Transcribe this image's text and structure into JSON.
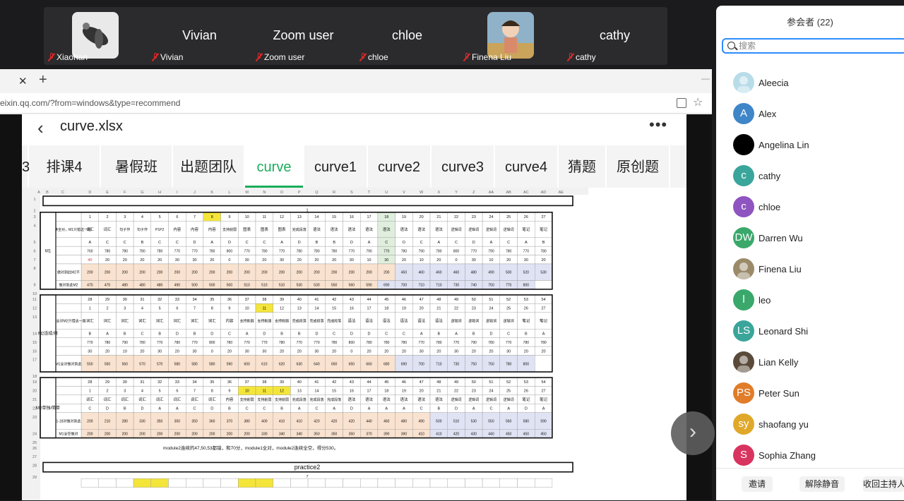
{
  "top_strip": {
    "tiles": [
      {
        "name": "Xiaohan",
        "big": "",
        "has_avatar": true
      },
      {
        "name": "Vivian",
        "big": "Vivian"
      },
      {
        "name": "Zoom user",
        "big": "Zoom user"
      },
      {
        "name": "chloe",
        "big": "chloe"
      },
      {
        "name": "Finena Liu",
        "big": "",
        "has_avatar": true
      },
      {
        "name": "cathy",
        "big": "cathy"
      }
    ]
  },
  "browser": {
    "tab_close": "✕",
    "new_tab": "+",
    "url": "eixin.qq.com/?from=windows&type=recommend"
  },
  "sheet_app": {
    "file_title": "curve.xlsx",
    "back_icon": "‹",
    "more_icon": "•••",
    "tabs": [
      {
        "label": "3"
      },
      {
        "label": "排课4"
      },
      {
        "label": "暑假班"
      },
      {
        "label": "出题团队"
      },
      {
        "label": "curve",
        "active": true
      },
      {
        "label": "curve1"
      },
      {
        "label": "curve2"
      },
      {
        "label": "curve3"
      },
      {
        "label": "curve4"
      },
      {
        "label": "猜题"
      },
      {
        "label": "原创题"
      }
    ],
    "col_letters": [
      "A",
      "B",
      "C",
      "D",
      "E",
      "F",
      "G",
      "H",
      "I",
      "J",
      "K",
      "L",
      "M",
      "N",
      "O",
      "P",
      "Q",
      "R",
      "S",
      "T",
      "U",
      "V",
      "W",
      "X",
      "Y",
      "Z",
      "AA",
      "AB",
      "AC",
      "AD",
      "AE"
    ],
    "blocks": [
      {
        "label": "M1",
        "heading": "practice1",
        "subnum": "1",
        "rows": [
          {
            "hdr": "",
            "cells": [
              "1",
              "2",
              "3",
              "4",
              "5",
              "6",
              "7",
              "8",
              "9",
              "10",
              "11",
              "12",
              "13",
              "14",
              "15",
              "16",
              "17",
              "18",
              "19",
              "20",
              "21",
              "22",
              "23",
              "24",
              "25",
              "26",
              "27"
            ]
          },
          {
            "hdr": "M2连续全对，M1只错这一题",
            "cells": [
              "词汇",
              "词汇",
              "句子作",
              "句子作",
              "P1P2",
              "内容",
              "内容",
              "内容",
              "支持削弱",
              "图表",
              "图表",
              "图表",
              "完成段落",
              "语法",
              "语法",
              "语法",
              "语法",
              "语法",
              "语法",
              "语法",
              "语法",
              "逻辑词",
              "逻辑词",
              "逻辑词",
              "逻辑词",
              "笔记",
              "笔记"
            ]
          },
          {
            "hdr": "",
            "cells": [
              "A",
              "C",
              "C",
              "B",
              "C",
              "C",
              "D",
              "A",
              "D",
              "C",
              "C",
              "A",
              "D",
              "B",
              "B",
              "D",
              "A",
              "C",
              "D",
              "C",
              "A",
              "C",
              "D",
              "A",
              "C",
              "A",
              "B"
            ]
          },
          {
            "hdr": "",
            "cells": [
              "760",
              "780",
              "780",
              "780",
              "780",
              "770",
              "770",
              "780",
              "800",
              "770",
              "780",
              "770",
              "780",
              "780",
              "780",
              "770",
              "790",
              "770",
              "780",
              "790",
              "780",
              "800",
              "770",
              "790",
              "780",
              "770",
              "780"
            ]
          },
          {
            "hdr": "",
            "cells": [
              "40",
              "20",
              "20",
              "20",
              "20",
              "30",
              "30",
              "20",
              "0",
              "30",
              "20",
              "30",
              "20",
              "20",
              "20",
              "30",
              "10",
              "30",
              "20",
              "10",
              "20",
              "0",
              "30",
              "10",
              "20",
              "30",
              "20"
            ]
          },
          {
            "hdr": "做对到此M2不",
            "cells": [
              "200",
              "200",
              "200",
              "200",
              "200",
              "200",
              "200",
              "200",
              "200",
              "200",
              "200",
              "200",
              "200",
              "200",
              "200",
              "200",
              "200",
              "200",
              "450",
              "460",
              "460",
              "460",
              "480",
              "490",
              "500",
              "520",
              "530"
            ]
          },
          {
            "hdr": "做对到此M2",
            "cells": [
              "470",
              "470",
              "480",
              "480",
              "480",
              "490",
              "500",
              "500",
              "500",
              "510",
              "510",
              "510",
              "530",
              "530",
              "550",
              "560",
              "590",
              "690",
              "700",
              "710",
              "710",
              "730",
              "740",
              "750",
              "770",
              "800",
              ""
            ]
          }
        ]
      },
      {
        "label": "M2连续/难",
        "rows": [
          {
            "hdr": "",
            "cells": [
              "28",
              "29",
              "30",
              "31",
              "32",
              "33",
              "34",
              "35",
              "36",
              "37",
              "38",
              "39",
              "40",
              "41",
              "42",
              "43",
              "44",
              "45",
              "46",
              "47",
              "48",
              "49",
              "50",
              "51",
              "52",
              "53",
              "54"
            ]
          },
          {
            "hdr": "",
            "cells": [
              "1",
              "2",
              "3",
              "4",
              "5",
              "6",
              "7",
              "8",
              "9",
              "10",
              "11",
              "12",
              "13",
              "14",
              "15",
              "16",
              "17",
              "18",
              "19",
              "20",
              "21",
              "22",
              "23",
              "24",
              "25",
              "26",
              "27"
            ]
          },
          {
            "hdr": "M1全对M2只错这一题",
            "cells": [
              "词汇",
              "词汇",
              "词汇",
              "词汇",
              "词汇",
              "词汇",
              "词汇",
              "词汇",
              "内容",
              "支持削弱",
              "支持削弱",
              "支持削弱",
              "完成段落",
              "完成段落",
              "完成段落",
              "语法",
              "语法",
              "语法",
              "语法",
              "语法",
              "语法",
              "逻辑词",
              "逻辑词",
              "逻辑词",
              "逻辑词",
              "笔记",
              "笔记"
            ]
          },
          {
            "hdr": "",
            "cells": [
              "B",
              "A",
              "B",
              "C",
              "B",
              "D",
              "B",
              "D",
              "C",
              "A",
              "D",
              "B",
              "B",
              "D",
              "C",
              "D",
              "D",
              "C",
              "C",
              "A",
              "B",
              "A",
              "B",
              "D",
              "C",
              "B",
              "A"
            ]
          },
          {
            "hdr": "",
            "cells": [
              "770",
              "780",
              "790",
              "780",
              "770",
              "780",
              "770",
              "800",
              "780",
              "770",
              "770",
              "780",
              "770",
              "770",
              "780",
              "800",
              "780",
              "780",
              "780",
              "770",
              "780",
              "770",
              "790",
              "780",
              "770",
              "780",
              "780"
            ]
          },
          {
            "hdr": "",
            "cells": [
              "30",
              "20",
              "10",
              "20",
              "30",
              "20",
              "30",
              "0",
              "20",
              "30",
              "30",
              "20",
              "20",
              "30",
              "20",
              "0",
              "20",
              "20",
              "20",
              "30",
              "20",
              "30",
              "20",
              "20",
              "30",
              "20",
              "20"
            ]
          },
          {
            "hdr": "M1全对做对到此",
            "cells": [
              "550",
              "550",
              "560",
              "570",
              "570",
              "580",
              "580",
              "580",
              "590",
              "600",
              "610",
              "620",
              "630",
              "640",
              "650",
              "650",
              "660",
              "680",
              "690",
              "700",
              "710",
              "730",
              "750",
              "750",
              "780",
              "800",
              ""
            ]
          }
        ]
      },
      {
        "label": "M2单独/简单",
        "rows": [
          {
            "hdr": "",
            "cells": [
              "28",
              "29",
              "30",
              "31",
              "32",
              "33",
              "34",
              "35",
              "36",
              "37",
              "38",
              "39",
              "40",
              "41",
              "42",
              "43",
              "44",
              "45",
              "46",
              "47",
              "48",
              "49",
              "50",
              "51",
              "52",
              "53",
              "54"
            ]
          },
          {
            "hdr": "",
            "cells": [
              "1",
              "2",
              "3",
              "4",
              "5",
              "6",
              "7",
              "8",
              "9",
              "10",
              "11",
              "12",
              "13",
              "14",
              "15",
              "16",
              "17",
              "18",
              "19",
              "20",
              "21",
              "22",
              "23",
              "24",
              "25",
              "26",
              "27"
            ]
          },
          {
            "hdr": "",
            "cells": [
              "词汇",
              "词汇",
              "词汇",
              "词汇",
              "词汇",
              "词汇",
              "词汇",
              "词汇",
              "内容",
              "支持削弱",
              "支持削弱",
              "支持削弱",
              "完成段落",
              "完成段落",
              "完成段落",
              "语法",
              "语法",
              "语法",
              "语法",
              "语法",
              "语法",
              "逻辑词",
              "逻辑词",
              "逻辑词",
              "逻辑词",
              "笔记",
              "笔记"
            ]
          },
          {
            "hdr": "",
            "cells": [
              "C",
              "D",
              "B",
              "D",
              "A",
              "A",
              "C",
              "D",
              "B",
              "C",
              "C",
              "B",
              "A",
              "C",
              "A",
              "D",
              "A",
              "A",
              "A",
              "C",
              "B",
              "D",
              "A",
              "C",
              "A",
              "D",
              "A"
            ]
          },
          {
            "hdr": "1-18对做对到此",
            "cells": [
              "200",
              "210",
              "280",
              "330",
              "350",
              "350",
              "350",
              "360",
              "370",
              "380",
              "400",
              "410",
              "410",
              "420",
              "420",
              "420",
              "440",
              "460",
              "480",
              "490",
              "500",
              "510",
              "530",
              "550",
              "560",
              "580",
              "590"
            ]
          },
          {
            "hdr": "M1全空做对",
            "cells": [
              "200",
              "200",
              "200",
              "200",
              "200",
              "200",
              "200",
              "200",
              "200",
              "200",
              "330",
              "340",
              "340",
              "350",
              "350",
              "350",
              "370",
              "390",
              "390",
              "410",
              "410",
              "420",
              "430",
              "440",
              "450",
              "450",
              "450"
            ]
          }
        ]
      }
    ],
    "note": "module2连续的47,50,53都错，和70分，module1全对，module2连续全空，得分530。",
    "heading2": "practice2",
    "subnum2": "7"
  },
  "next_arrow": "›",
  "panel": {
    "title": "参会者 (22)",
    "search_placeholder": "搜索",
    "participants": [
      {
        "initials": "",
        "name": "Aleecia",
        "color": "#b9dce9",
        "photo": true
      },
      {
        "initials": "A",
        "name": "Alex",
        "color": "#3f86c8"
      },
      {
        "initials": "",
        "name": "Angelina Lin",
        "color": "#000000"
      },
      {
        "initials": "c",
        "name": "cathy",
        "color": "#3aa59a"
      },
      {
        "initials": "c",
        "name": "chloe",
        "color": "#8e54c0"
      },
      {
        "initials": "DW",
        "name": "Darren Wu",
        "color": "#3aa86b"
      },
      {
        "initials": "",
        "name": "Finena Liu",
        "color": "#9a8a6a",
        "photo": true
      },
      {
        "initials": "l",
        "name": "leo",
        "color": "#3aa86b"
      },
      {
        "initials": "LS",
        "name": "Leonard Shi",
        "color": "#3aa59a"
      },
      {
        "initials": "",
        "name": "Lian Kelly",
        "color": "#5a4a3a",
        "photo": true
      },
      {
        "initials": "PS",
        "name": "Peter Sun",
        "color": "#e07c2a"
      },
      {
        "initials": "sy",
        "name": "shaofang yu",
        "color": "#e0a82a"
      },
      {
        "initials": "S",
        "name": "Sophia Zhang",
        "color": "#d8345f"
      }
    ],
    "footer": {
      "invite": "邀请",
      "unmute": "解除静音",
      "reclaim": "收回主持人"
    }
  }
}
